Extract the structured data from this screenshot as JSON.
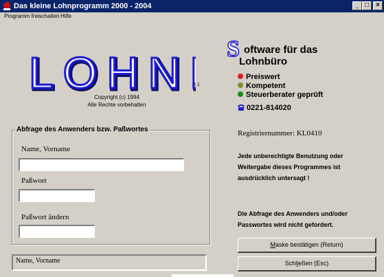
{
  "window": {
    "title": "Das kleine Lohnprogramm 2000 - 2004",
    "buttons": {
      "minimize": "_",
      "maximize": "□",
      "close": "×"
    }
  },
  "menu": {
    "items": [
      "Programm freischalten",
      "Hilfe"
    ]
  },
  "logo": {
    "text": "LOHNI",
    "version": "3.1",
    "copyright": [
      "Copyright (c) 1994",
      "Alle Rechte vorbehalten"
    ]
  },
  "advert": {
    "headline_initial": "S",
    "headline_rest": "oftware für das",
    "headline_line2": "Lohnbüro",
    "features": [
      {
        "label": "Preiswert",
        "color": "#e02020"
      },
      {
        "label": "Kompetent",
        "color": "#8a8a2a"
      },
      {
        "label": "Steuerberater geprüft",
        "color": "#1a8a1a"
      }
    ],
    "phone": "0221-814020"
  },
  "login": {
    "group_label": "Abfrage des Anwenders bzw. Paßwortes",
    "name_label": "Name, Vorname",
    "name_value": "",
    "password_label": "Paßwort",
    "password_value": "",
    "password_change_label": "Paßwort ändern",
    "password_change_value": ""
  },
  "status_field": "Name, Vorname",
  "registration": "Registriernummer: KL0410",
  "warning": [
    "Jede unberechtigte Benutzung oder",
    "Weitergabe dieses Programmes ist",
    "ausdrücklich untersagt !"
  ],
  "info": [
    "Die Abfrage des Anwenders und/oder",
    "Passwortes wird nicht gefordert."
  ],
  "buttons": {
    "confirm_initial": "M",
    "confirm_rest": "aske bestätigen (Return)",
    "close_prefix": "Schl",
    "close_initial": "i",
    "close_rest": "eßen (Esc)"
  }
}
